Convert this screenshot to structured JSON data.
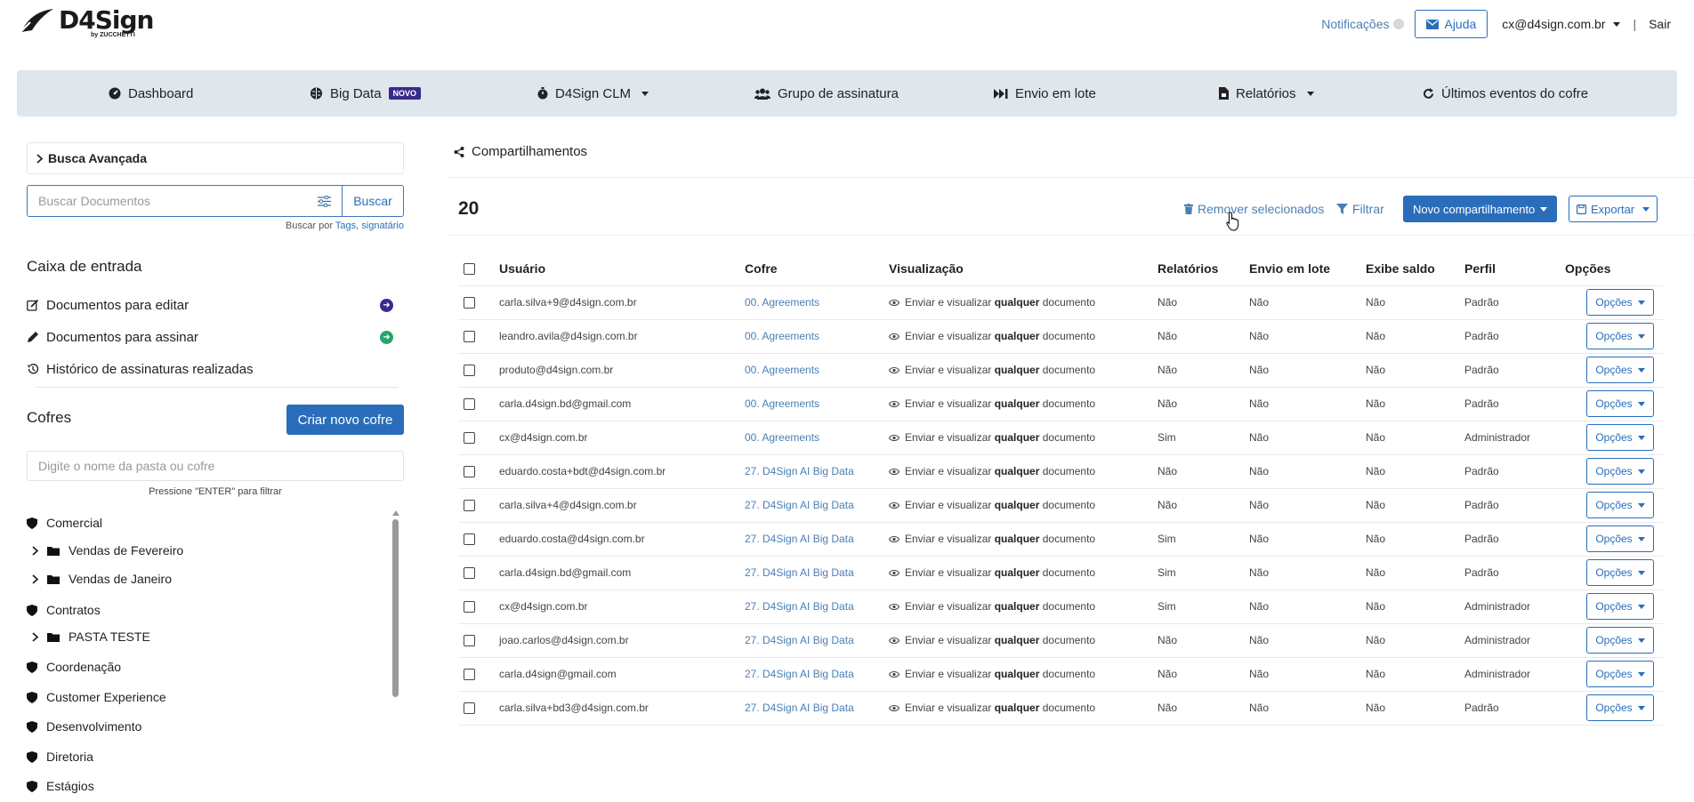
{
  "header": {
    "logo_title": "D4Sign",
    "logo_sub": "by ZUCCHETTI",
    "notifications_label": "Notificações",
    "help_label": "Ajuda",
    "user_email": "cx@d4sign.com.br",
    "separator": "|",
    "logout_label": "Sair"
  },
  "nav": {
    "dashboard": "Dashboard",
    "bigdata": "Big Data",
    "bigdata_badge": "NOVO",
    "clm": "D4Sign CLM",
    "group": "Grupo de assinatura",
    "batch": "Envio em lote",
    "reports": "Relatórios",
    "events": "Últimos eventos do cofre"
  },
  "sidebar": {
    "advanced_search": "Busca Avançada",
    "search_placeholder": "Buscar Documentos",
    "search_button": "Buscar",
    "search_help_prefix": "Buscar por",
    "search_help_tags": "Tags",
    "search_help_signer": "signatário",
    "inbox_title": "Caixa de entrada",
    "inbox_items": [
      "Documentos para editar",
      "Documentos para assinar",
      "Histórico de assinaturas realizadas"
    ],
    "vaults_title": "Cofres",
    "new_vault_button": "Criar novo cofre",
    "folder_placeholder": "Digite o nome da pasta ou cofre",
    "folder_hint": "Pressione \"ENTER\" para filtrar",
    "tree": {
      "vault_comercial": "Comercial",
      "folder_fev": "Vendas de Fevereiro",
      "folder_jan": "Vendas de Janeiro",
      "vault_contratos": "Contratos",
      "folder_teste": "PASTA TESTE",
      "vault_coord": "Coordenação",
      "vault_cx": "Customer Experience",
      "vault_dev": "Desenvolvimento",
      "vault_dir": "Diretoria",
      "vault_est": "Estágios"
    }
  },
  "main": {
    "title": "Compartilhamentos",
    "count": "20",
    "remove_selected": "Remover selecionados",
    "filter": "Filtrar",
    "new_share": "Novo compartilhamento",
    "export": "Exportar",
    "columns": [
      "Usuário",
      "Cofre",
      "Visualização",
      "Relatórios",
      "Envio em lote",
      "Exibe saldo",
      "Perfil",
      "Opções"
    ],
    "viz_prefix": "Enviar e visualizar",
    "viz_bold": "qualquer",
    "viz_suffix": "documento",
    "options_label": "Opções",
    "rows": [
      {
        "user": "carla.silva+9@d4sign.com.br",
        "vault": "00. Agreements",
        "reports": "Não",
        "batch": "Não",
        "balance": "Não",
        "profile": "Padrão"
      },
      {
        "user": "leandro.avila@d4sign.com.br",
        "vault": "00. Agreements",
        "reports": "Não",
        "batch": "Não",
        "balance": "Não",
        "profile": "Padrão"
      },
      {
        "user": "produto@d4sign.com.br",
        "vault": "00. Agreements",
        "reports": "Não",
        "batch": "Não",
        "balance": "Não",
        "profile": "Padrão"
      },
      {
        "user": "carla.d4sign.bd@gmail.com",
        "vault": "00. Agreements",
        "reports": "Não",
        "batch": "Não",
        "balance": "Não",
        "profile": "Padrão"
      },
      {
        "user": "cx@d4sign.com.br",
        "vault": "00. Agreements",
        "reports": "Sim",
        "batch": "Não",
        "balance": "Não",
        "profile": "Administrador"
      },
      {
        "user": "eduardo.costa+bdt@d4sign.com.br",
        "vault": "27. D4Sign AI Big Data",
        "reports": "Não",
        "batch": "Não",
        "balance": "Não",
        "profile": "Padrão"
      },
      {
        "user": "carla.silva+4@d4sign.com.br",
        "vault": "27. D4Sign AI Big Data",
        "reports": "Não",
        "batch": "Não",
        "balance": "Não",
        "profile": "Padrão"
      },
      {
        "user": "eduardo.costa@d4sign.com.br",
        "vault": "27. D4Sign AI Big Data",
        "reports": "Sim",
        "batch": "Não",
        "balance": "Não",
        "profile": "Padrão"
      },
      {
        "user": "carla.d4sign.bd@gmail.com",
        "vault": "27. D4Sign AI Big Data",
        "reports": "Sim",
        "batch": "Não",
        "balance": "Não",
        "profile": "Padrão"
      },
      {
        "user": "cx@d4sign.com.br",
        "vault": "27. D4Sign AI Big Data",
        "reports": "Sim",
        "batch": "Não",
        "balance": "Não",
        "profile": "Administrador"
      },
      {
        "user": "joao.carlos@d4sign.com.br",
        "vault": "27. D4Sign AI Big Data",
        "reports": "Não",
        "batch": "Não",
        "balance": "Não",
        "profile": "Administrador"
      },
      {
        "user": "carla.d4sign@gmail.com",
        "vault": "27. D4Sign AI Big Data",
        "reports": "Não",
        "batch": "Não",
        "balance": "Não",
        "profile": "Administrador"
      },
      {
        "user": "carla.silva+bd3@d4sign.com.br",
        "vault": "27. D4Sign AI Big Data",
        "reports": "Não",
        "batch": "Não",
        "balance": "Não",
        "profile": "Padrão"
      }
    ]
  }
}
